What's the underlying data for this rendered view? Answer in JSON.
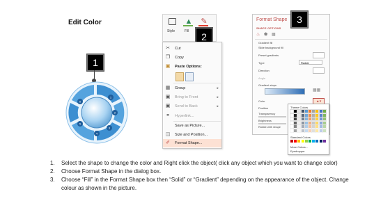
{
  "slide_title": "Edit Color",
  "badges": [
    "1",
    "2",
    "3"
  ],
  "diagram_labels": [
    "1",
    "2",
    "3",
    "4",
    "5",
    "6"
  ],
  "ribbon": {
    "style_label": "Style",
    "fill_label": "Fill",
    "outline_label": "Outline"
  },
  "context_menu": {
    "items": [
      {
        "label": "Cut",
        "icon": "scissors-icon"
      },
      {
        "label": "Copy",
        "icon": "copy-icon"
      },
      {
        "label": "Paste Options:",
        "icon": "clipboard-icon"
      },
      {
        "label": "Group",
        "icon": "group-icon"
      },
      {
        "label": "Bring to Front",
        "icon": "bring-front-icon"
      },
      {
        "label": "Send to Back",
        "icon": "send-back-icon"
      },
      {
        "label": "Hyperlink...",
        "icon": "link-icon"
      },
      {
        "label": "Save as Picture...",
        "icon": "none"
      },
      {
        "label": "Size and Position...",
        "icon": "size-icon"
      },
      {
        "label": "Format Shape...",
        "icon": "format-shape-icon"
      }
    ]
  },
  "format_pane": {
    "title": "Format Shape",
    "tab": "SHAPE OPTIONS",
    "rows": [
      "Gradient fill",
      "Slide background fill",
      "Preset gradients",
      "Type",
      "Radial",
      "Direction",
      "Angle",
      "Gradient stops",
      "Color",
      "Position",
      "Transparency",
      "Brightness",
      "Rotate with shape"
    ],
    "palette_theme": "Theme Colors",
    "palette_standard": "Standard Colors",
    "palette_more": "More Colors...",
    "palette_eyedropper": "Eyedropper"
  },
  "instructions": [
    {
      "num": "1.",
      "text": "Select the shape to change the color and Right click the object( click any object which you want to change color)"
    },
    {
      "num": "2.",
      "text": "Choose Format Shape in the dialog box."
    },
    {
      "num": "3.",
      "text": "Choose “Fill” in the Format Shape box then “Solid” or “Gradient” depending on the appearance of the object. Change colour as shown in the picture."
    }
  ],
  "colors": {
    "accent": "#c0504d",
    "diagram_blue": "#3d8fd1",
    "diagram_light": "#a9d3f2",
    "menu_highlight": "#fde1d4"
  }
}
